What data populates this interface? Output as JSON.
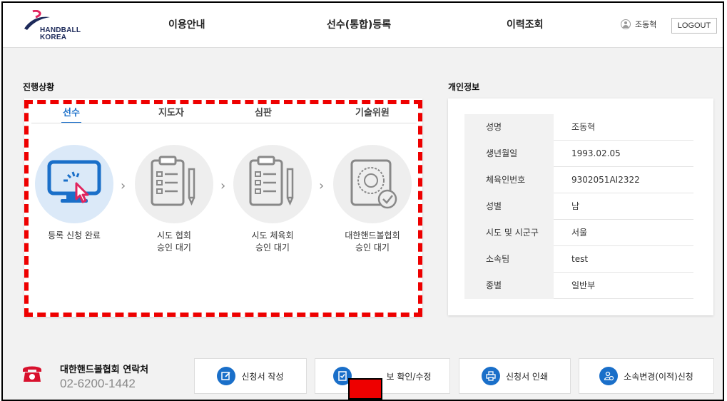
{
  "header": {
    "logo_line1": "HANDBALL",
    "logo_line2": "KOREA",
    "nav": [
      "이용안내",
      "선수(통합)등록",
      "이력조회"
    ],
    "user_name": "조동혁",
    "logout_label": "LOGOUT"
  },
  "progress": {
    "title": "진행상황",
    "tabs": [
      "선수",
      "지도자",
      "심판",
      "기술위원"
    ],
    "active_tab": "선수",
    "steps": [
      {
        "line1": "등록 신청 완료",
        "line2": ""
      },
      {
        "line1": "시도 협회",
        "line2": "승인 대기"
      },
      {
        "line1": "시도 체육회",
        "line2": "승인 대기"
      },
      {
        "line1": "대한핸드볼협회",
        "line2": "승인 대기"
      }
    ]
  },
  "personal": {
    "title": "개인정보",
    "rows": [
      {
        "key": "성명",
        "value": "조동혁"
      },
      {
        "key": "생년월일",
        "value": "1993.02.05"
      },
      {
        "key": "체육인번호",
        "value": "9302051AI2322"
      },
      {
        "key": "성별",
        "value": "남"
      },
      {
        "key": "시도 및 시군구",
        "value": "서울"
      },
      {
        "key": "소속팀",
        "value": "test"
      },
      {
        "key": "종별",
        "value": "일반부"
      }
    ]
  },
  "footer": {
    "contact_title": "대한핸드볼협회 연락처",
    "contact_phone": "02-6200-1442",
    "buttons": [
      "신청서 작성",
      "보 확인/수정",
      "신청서 인쇄",
      "소속변경(이적)신청"
    ]
  },
  "colors": {
    "accent": "#1a6fc9",
    "highlight": "#ee0000"
  }
}
